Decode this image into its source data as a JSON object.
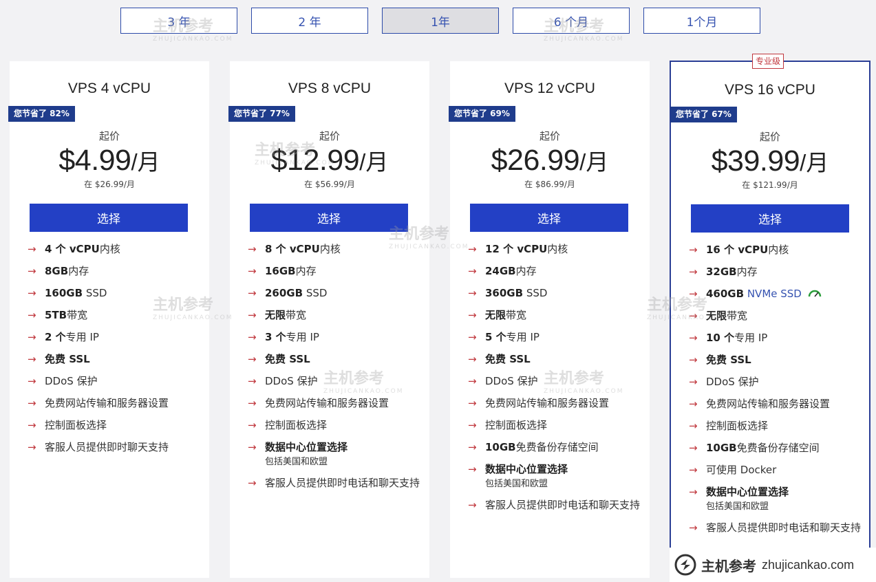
{
  "terms": [
    {
      "label": "3 年",
      "active": false
    },
    {
      "label": "2 年",
      "active": false
    },
    {
      "label": "1年",
      "active": true
    },
    {
      "label": "6 个月",
      "active": false
    },
    {
      "label": "1个月",
      "active": false
    }
  ],
  "plans": [
    {
      "title": "VPS 4 vCPU",
      "save": "您节省了 82%",
      "from": "起价",
      "price": "$4.99",
      "unit": "/月",
      "orig": "在 $26.99/月",
      "cta": "选择",
      "features": [
        {
          "bold": "4 个 vCPU",
          "text": "内核"
        },
        {
          "bold": "8GB",
          "text": "内存"
        },
        {
          "bold": "160GB",
          "text": " SSD"
        },
        {
          "bold": "5TB",
          "text": "带宽"
        },
        {
          "bold": "2 个",
          "text": "专用 IP"
        },
        {
          "bold": "免费 SSL",
          "text": ""
        },
        {
          "bold": "",
          "text": "DDoS 保护"
        },
        {
          "bold": "",
          "text": "免费网站传输和服务器设置"
        },
        {
          "bold": "",
          "text": "控制面板选择"
        },
        {
          "bold": "",
          "text": "客服人员提供即时聊天支持"
        }
      ]
    },
    {
      "title": "VPS 8 vCPU",
      "save": "您节省了 77%",
      "from": "起价",
      "price": "$12.99",
      "unit": "/月",
      "orig": "在 $56.99/月",
      "cta": "选择",
      "features": [
        {
          "bold": "8 个 vCPU",
          "text": "内核"
        },
        {
          "bold": "16GB",
          "text": "内存"
        },
        {
          "bold": "260GB",
          "text": " SSD"
        },
        {
          "bold": "无限",
          "text": "带宽"
        },
        {
          "bold": "3 个",
          "text": "专用 IP"
        },
        {
          "bold": "免费 SSL",
          "text": ""
        },
        {
          "bold": "",
          "text": "DDoS 保护"
        },
        {
          "bold": "",
          "text": "免费网站传输和服务器设置"
        },
        {
          "bold": "",
          "text": "控制面板选择"
        },
        {
          "bold": "数据中心位置选择",
          "text": "",
          "sub": "包括美国和欧盟"
        },
        {
          "bold": "",
          "text": "客服人员提供即时电话和聊天支持"
        }
      ]
    },
    {
      "title": "VPS 12 vCPU",
      "save": "您节省了 69%",
      "from": "起价",
      "price": "$26.99",
      "unit": "/月",
      "orig": "在 $86.99/月",
      "cta": "选择",
      "features": [
        {
          "bold": "12 个 vCPU",
          "text": "内核"
        },
        {
          "bold": "24GB",
          "text": "内存"
        },
        {
          "bold": "360GB",
          "text": " SSD"
        },
        {
          "bold": "无限",
          "text": "带宽"
        },
        {
          "bold": "5 个",
          "text": "专用 IP"
        },
        {
          "bold": "免费 SSL",
          "text": ""
        },
        {
          "bold": "",
          "text": "DDoS 保护"
        },
        {
          "bold": "",
          "text": "免费网站传输和服务器设置"
        },
        {
          "bold": "",
          "text": "控制面板选择"
        },
        {
          "bold": "10GB",
          "text": "免费备份存储空间"
        },
        {
          "bold": "数据中心位置选择",
          "text": "",
          "sub": "包括美国和欧盟"
        },
        {
          "bold": "",
          "text": "客服人员提供即时电话和聊天支持"
        }
      ]
    },
    {
      "title": "VPS 16 vCPU",
      "badge": "专业级",
      "save": "您节省了 67%",
      "from": "起价",
      "price": "$39.99",
      "unit": "/月",
      "orig": "在 $121.99/月",
      "cta": "选择",
      "features": [
        {
          "bold": "16 个 vCPU",
          "text": "内核"
        },
        {
          "bold": "32GB",
          "text": "内存"
        },
        {
          "bold": "460GB",
          "text": " NVMe SSD",
          "nvme": true,
          "icon": "speed-icon"
        },
        {
          "bold": "无限",
          "text": "带宽"
        },
        {
          "bold": "10 个",
          "text": "专用 IP"
        },
        {
          "bold": "免费 SSL",
          "text": ""
        },
        {
          "bold": "",
          "text": "DDoS 保护"
        },
        {
          "bold": "",
          "text": "免费网站传输和服务器设置"
        },
        {
          "bold": "",
          "text": "控制面板选择"
        },
        {
          "bold": "10GB",
          "text": "免费备份存储空间"
        },
        {
          "bold": "",
          "text": "可使用 Docker"
        },
        {
          "bold": "数据中心位置选择",
          "text": "",
          "sub": "包括美国和欧盟"
        },
        {
          "bold": "",
          "text": "客服人员提供即时电话和聊天支持"
        }
      ]
    }
  ],
  "watermark": {
    "cn": "主机参考",
    "url": "zhujicankao.com",
    "latin": "ZHUJICANKAO.COM"
  },
  "colors": {
    "accent": "#2340c5",
    "badge": "#1f3c8c",
    "arrow": "#c0363c"
  }
}
